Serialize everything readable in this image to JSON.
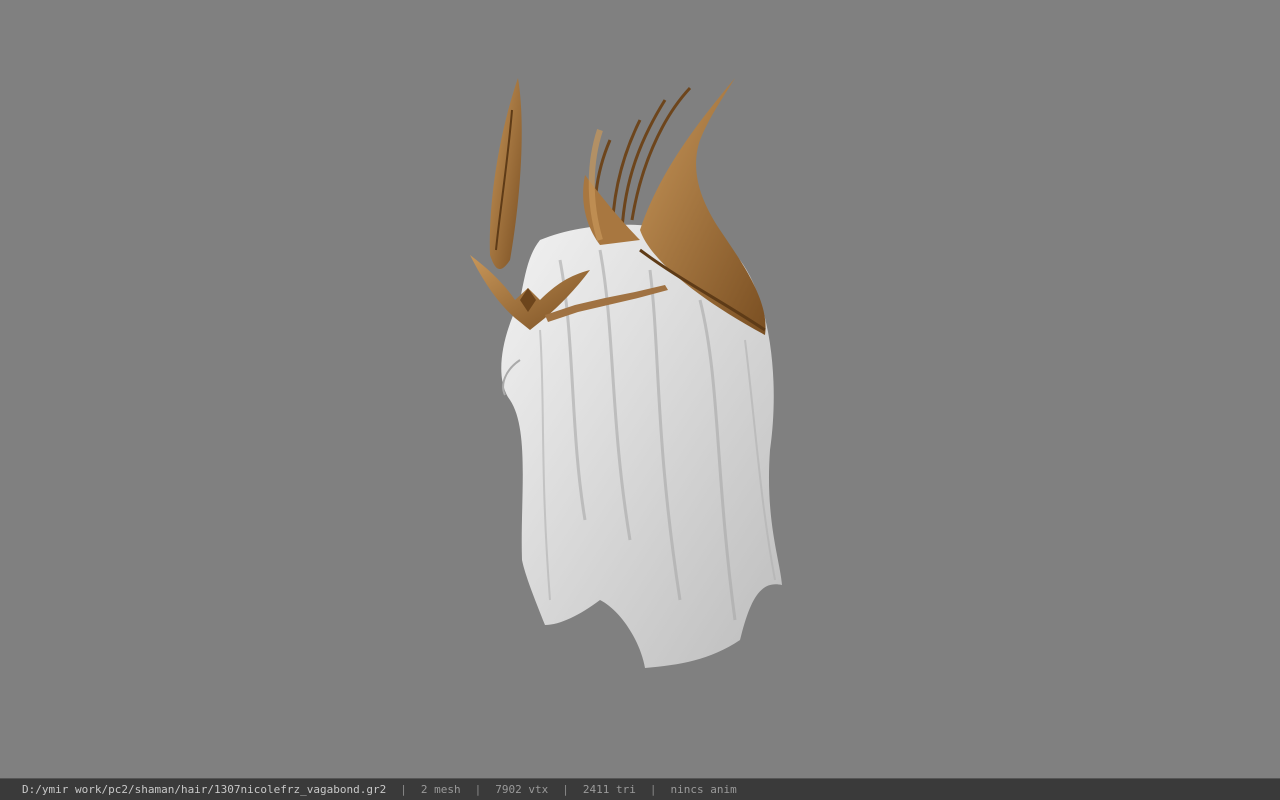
{
  "viewport": {
    "background_color": "#808080",
    "model": {
      "hair_color": "#dcdcdc",
      "crown_color": "#9a6b34"
    }
  },
  "statusbar": {
    "file_path": "D:/ymir work/pc2/shaman/hair/1307nicolefrz_vagabond.gr2",
    "mesh_count": "2 mesh",
    "vertex_count": "7902 vtx",
    "triangle_count": "2411 tri",
    "anim_status": "nincs anim",
    "separator": "|"
  }
}
